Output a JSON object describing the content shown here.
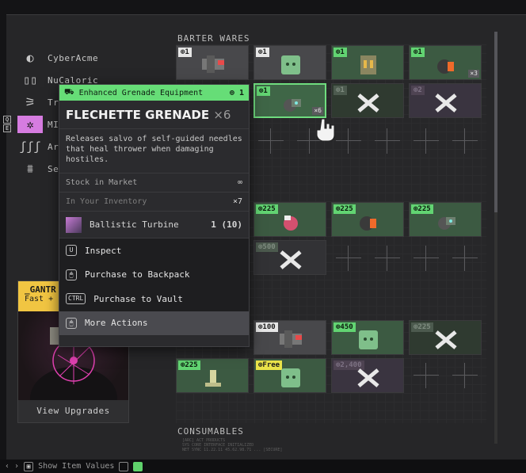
{
  "vendors": [
    {
      "name": "CyberAcme",
      "icon": "cyberacme-logo-icon"
    },
    {
      "name": "NuCaloric",
      "icon": "nucaloric-logo-icon"
    },
    {
      "name": "Tr",
      "icon": "traxus-logo-icon"
    },
    {
      "name": "MI",
      "icon": "mida-logo-icon"
    },
    {
      "name": "Ar",
      "icon": "arachne-logo-icon"
    },
    {
      "name": "Se",
      "icon": "sekiguchi-logo-icon"
    }
  ],
  "upgrade_card": {
    "banner_title": "_GANTR",
    "banner_sub": "Fast +",
    "button": "View Upgrades"
  },
  "market": {
    "barter_title": "BARTER WARES",
    "consumables_title": "CONSUMABLES",
    "row1": [
      {
        "badge": "1",
        "style": "grey",
        "item": "launcher-icon"
      },
      {
        "badge": "1",
        "style": "grey",
        "item": "green-crate-icon"
      },
      {
        "badge": "1",
        "style": "green",
        "item": "ammo-pack-icon"
      },
      {
        "badge": "1",
        "style": "green",
        "item": "frag-grenade-icon",
        "qty": "×3"
      }
    ],
    "row2": [
      {
        "badge": "1",
        "style": "hl",
        "item": "flechette-grenade-icon",
        "qty": "×6"
      },
      {
        "badge": "1",
        "style": "lockedg",
        "item": "locked-icon"
      },
      {
        "badge": "2",
        "style": "lockedp",
        "item": "locked-icon"
      }
    ],
    "row4": [
      {
        "badge": "225",
        "item": "pink-grenade-icon"
      },
      {
        "badge": "225",
        "item": "frag-grenade-icon"
      },
      {
        "badge": "225",
        "item": "flechette-grenade-icon"
      }
    ],
    "row5_badge": "500",
    "row7": [
      {
        "badge": "100",
        "style": "white",
        "item": "launcher-icon"
      },
      {
        "badge": "450",
        "style": "green",
        "item": "green-crate-icon"
      },
      {
        "badge": "225",
        "style": "lockedg",
        "item": "locked-icon"
      }
    ],
    "row8": [
      {
        "badge": "225",
        "style": "green",
        "item": "trophy-icon"
      },
      {
        "badge": "Free",
        "style": "yellow",
        "item": "green-crate-icon"
      },
      {
        "badge": "2,400",
        "style": "lockedp",
        "item": "locked-icon"
      }
    ]
  },
  "tooltip": {
    "category": "Enhanced Grenade Equipment",
    "count": "1",
    "title": "FLECHETTE GRENADE",
    "multiplier": "×6",
    "description": "Releases salvo of self-guided needles that heal thrower when damaging hostiles.",
    "stock_label": "Stock in Market",
    "stock_value": "∞",
    "inventory_label": "In Your Inventory",
    "inventory_value": "×7",
    "cost_name": "Ballistic Turbine",
    "cost_value": "1 (10)",
    "actions": [
      {
        "key": "U",
        "label": "Inspect"
      },
      {
        "key": "🖱",
        "label": "Purchase to Backpack"
      },
      {
        "key": "CTRL",
        "label": "Purchase to Vault"
      },
      {
        "key": "🖱",
        "label": "More Actions"
      }
    ]
  },
  "bottom_bar": {
    "show_item_values_label": "Show Item Values"
  },
  "footer_text": [
    "[ARC] ACT PRODUCTS",
    "SYS CORE INTERFACE INITIALIZED",
    "NET SYNC 11.22.11 45.62.98.71 ... [SECURE]"
  ],
  "colors": {
    "accent_green": "#66dd77",
    "active_vendor": "#d67ce0",
    "banner_yellow": "#f1c542"
  }
}
